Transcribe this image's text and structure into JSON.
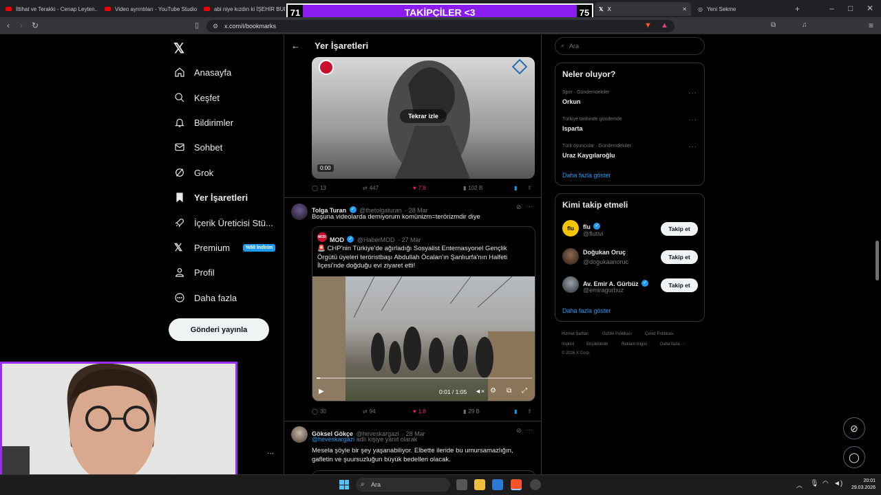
{
  "browser": {
    "tabs": [
      "İttihat ve Terakki - Cenap Leyten...",
      "Video ayrıntıları - YouTube Studio",
      "abi niye kızdın ki İŞEHİR BULMA...",
      "X",
      "Yeni Sekme"
    ],
    "url": "x.com/i/bookmarks"
  },
  "overlay": {
    "left_count": "71",
    "label": "TAKİPÇİLER <3",
    "right_count": "75"
  },
  "nav": {
    "items": [
      "Anasayfa",
      "Keşfet",
      "Bildirimler",
      "Sohbet",
      "Grok",
      "Yer İşaretleri",
      "İçerik Üreticisi Stü...",
      "Premium",
      "Profil",
      "Daha fazla"
    ],
    "premium_badge": "%50 İndirim",
    "post_button": "Gönderi yayınla"
  },
  "header": {
    "title": "Yer İşaretleri"
  },
  "posts": [
    {
      "video_label": "Tekrar izle",
      "video_time": "0:00",
      "stats": {
        "replies": "13",
        "reposts": "447",
        "likes": "7.8",
        "views": "102 B"
      }
    },
    {
      "name": "Tolga Turan",
      "handle": "@thetolgaturan",
      "date": "· 28 Mar",
      "text": "Boşuna videolarda demiyorum komünizm=terörizmdir diye",
      "quote": {
        "name": "MOD",
        "handle": "@HaberMOD",
        "date": "· 27 Mar",
        "text": "🚨 CHP'nin Türkiye'de ağırladığı Sosyalist Enternasyonel Gençlik Örgütü üyeleri teröristbaşı Abdullah Öcalan'ın Şanlıurfa'nın Halfeti İlçesi'nde doğduğu evi ziyaret etti!",
        "video_time": "0:01 / 1:05"
      },
      "stats": {
        "replies": "30",
        "reposts": "94",
        "likes": "1.8",
        "views": "29 B"
      }
    },
    {
      "name": "Göksel Gökçe",
      "handle": "@heveskargazi",
      "date": "· 28 Mar",
      "reply_to_handle": "@heveskargazi",
      "reply_to_suffix": "adlı kişiye yanıt olarak",
      "text": "Mesela şöyle bir şey yaşanabiliyor. Elbette ileride bu umursamazlığın, gafletin ve şuursuzluğun büyük bedelleri olacak."
    }
  ],
  "search": {
    "placeholder": "Ara"
  },
  "trends": {
    "title": "Neler oluyor?",
    "items": [
      {
        "category": "Spor · Gündemdekiler",
        "name": "Orkun"
      },
      {
        "category": "Türkiye tarihinde gündemde",
        "name": "Isparta"
      },
      {
        "category": "Türk oyuncular · Gündemdekiler",
        "name": "Uraz Kaygılaroğlu"
      }
    ],
    "more": "Daha fazla göster"
  },
  "who_to_follow": {
    "title": "Kimi takip etmeli",
    "items": [
      {
        "name": "flu",
        "handle": "@flutivi",
        "button": "Takip et"
      },
      {
        "name": "Doğukan Oruç",
        "handle": "@dogukaanoruc",
        "button": "Takip et"
      },
      {
        "name": "Av. Emir A. Gürbüz",
        "handle": "@emiragurbuz",
        "button": "Takip et"
      }
    ],
    "more": "Daha fazla göster"
  },
  "footer": {
    "links": [
      "Hizmet Şartları",
      "Gizlilik Politikası",
      "Çerez Politikası",
      "Imprint",
      "Erişilebilirlik",
      "Reklam bilgisi",
      "Daha fazla ···"
    ],
    "copyright": "© 2026 X Corp."
  },
  "taskbar": {
    "search": "Ara",
    "time": "20:01",
    "date": "29.03.2026"
  },
  "colors": {
    "accent": "#1d9bf0",
    "like": "#f91880",
    "overlay_bar": "#8a1cf0"
  }
}
